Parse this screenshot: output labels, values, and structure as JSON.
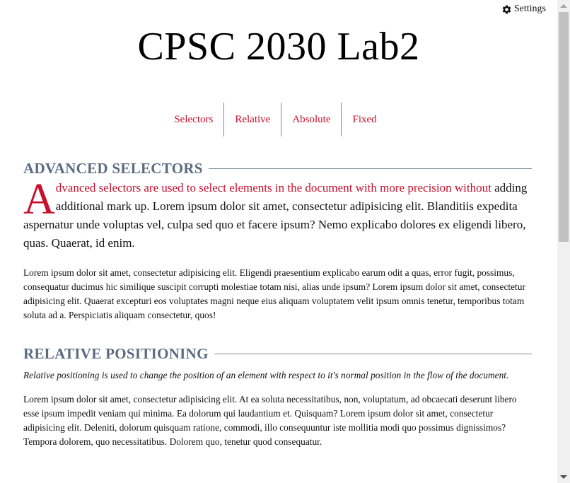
{
  "header": {
    "settings_label": "Settings",
    "settings_icon": "gear-icon",
    "title": "CPSC 2030 Lab2"
  },
  "nav": {
    "items": [
      {
        "label": "Selectors"
      },
      {
        "label": "Relative"
      },
      {
        "label": "Absolute"
      },
      {
        "label": "Fixed"
      }
    ]
  },
  "sections": [
    {
      "heading": "ADVANCED SELECTORS",
      "dropcap": "A",
      "lead_accent": "dvanced selectors are used to select elements in the document with more precision without",
      "lead_rest": "adding additional mark up. Lorem ipsum dolor sit amet, consectetur adipisicing elit. Blanditiis expedita aspernatur unde voluptas vel, culpa sed quo et facere ipsum? Nemo explicabo dolores ex eligendi libero, quas. Quaerat, id enim.",
      "body": "Lorem ipsum dolor sit amet, consectetur adipisicing elit. Eligendi praesentium explicabo earum odit a quas, error fugit, possimus, consequatur ducimus hic similique suscipit corrupti molestiae totam nisi, alias unde ipsum? Lorem ipsum dolor sit amet, consectetur adipisicing elit. Quaerat excepturi eos voluptates magni neque eius aliquam voluptatem velit ipsum omnis tenetur, temporibus totam soluta ad a. Perspiciatis aliquam consectetur, quos!"
    },
    {
      "heading": "RELATIVE POSITIONING",
      "italic_lead": "Relative positioning is used to change the position of an element with respect to it's normal position in the flow of the document.",
      "body": "Lorem ipsum dolor sit amet, consectetur adipisicing elit. At ea soluta necessitatibus, non, voluptatum, ad obcaecati deserunt libero esse ipsum impedit veniam qui minima. Ea dolorum qui laudantium et. Quisquam? Lorem ipsum dolor sit amet, consectetur adipisicing elit. Deleniti, dolorum quisquam ratione, commodi, illo consequuntur iste mollitia modi quo possimus dignissimos? Tempora dolorem, quo necessitatibus. Dolorem quo, tenetur quod consequatur."
    }
  ],
  "colors": {
    "accent": "#c8102e",
    "heading": "#5a6b80",
    "rule": "#7a8a9a"
  }
}
